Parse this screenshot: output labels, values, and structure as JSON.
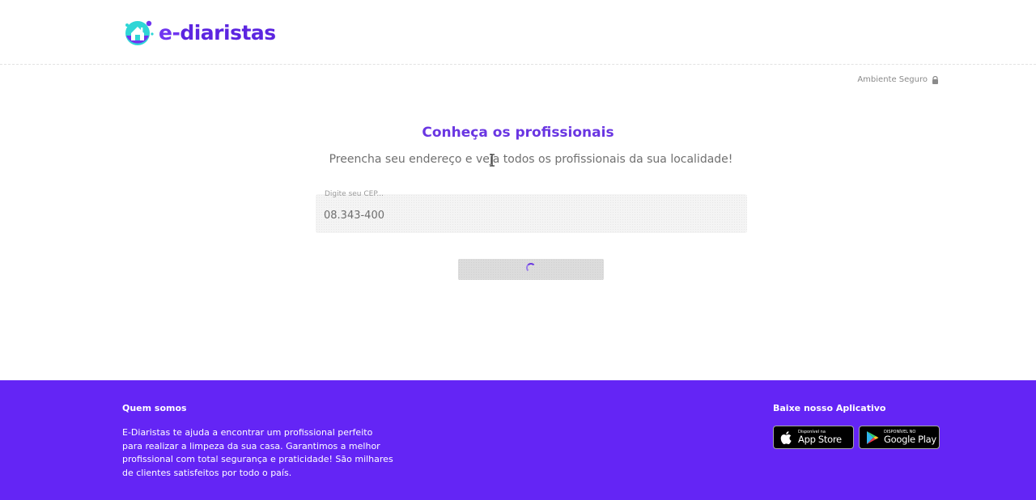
{
  "header": {
    "logo_text_e": "e-",
    "logo_text_rest": "diaristas"
  },
  "secure": {
    "label": "Ambiente Seguro",
    "icon": "lock-icon"
  },
  "main": {
    "title": "Conheça os profissionais",
    "subtitle": "Preencha seu endereço e veja todos os profissionais da sua localidade!",
    "cep_label": "Digite seu CEP...",
    "cep_value": "08.343-400",
    "search_state": "loading"
  },
  "footer": {
    "about_title": "Quem somos",
    "about_text": "E-Diaristas te ajuda a encontrar um profissional perfeito para realizar a limpeza da sua casa. Garantimos a melhor profissional com total segurança e praticidade! São milhares de clientes satisfeitos por todo o país.",
    "app_title": "Baixe nosso Aplicativo",
    "app_store_small": "Disponível na",
    "app_store_big": "App Store",
    "google_play_small": "DISPONÍVEL NO",
    "google_play_big": "Google Play"
  },
  "colors": {
    "brand": "#6425f5",
    "title": "#6a36e2"
  }
}
